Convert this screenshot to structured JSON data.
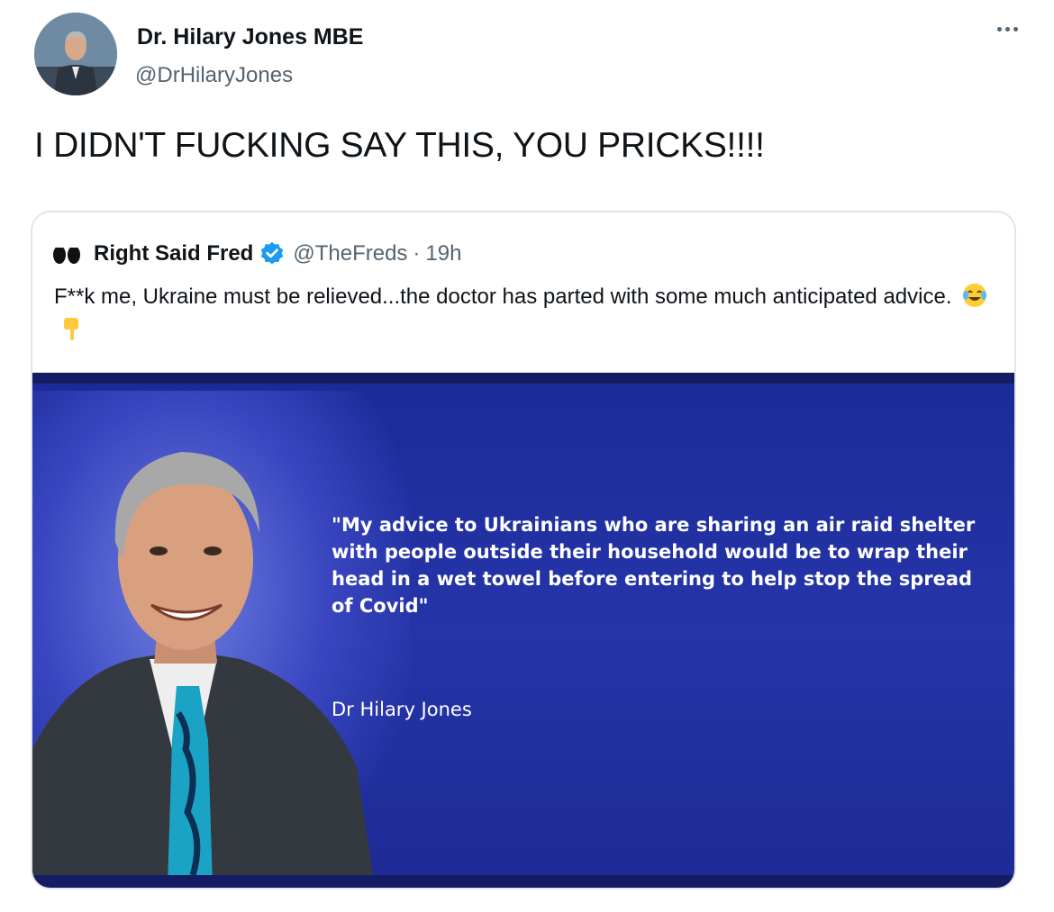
{
  "author": {
    "name": "Dr. Hilary Jones MBE",
    "handle": "@DrHilaryJones"
  },
  "tweet": {
    "text": "I DIDN'T FUCKING SAY THIS, YOU PRICKS!!!!"
  },
  "quoted_tweet": {
    "name": "Right Said Fred",
    "handle": "@TheFreds",
    "separator": "·",
    "time": "19h",
    "text": "F**k me, Ukraine must be relieved...the doctor has parted with some much anticipated advice.",
    "emojis": [
      "face-with-tears-of-joy",
      "backhand-index-pointing-down"
    ],
    "image": {
      "quote": "\"My advice to Ukrainians who are sharing an air raid shelter with people outside their household would be to wrap their head in a wet towel before entering to help stop the spread of Covid\"",
      "attribution": "Dr Hilary Jones",
      "background_color": "#2535a8"
    }
  },
  "icons": {
    "more": "more-horizontal-icon",
    "verified": "verified-badge-icon"
  },
  "colors": {
    "text": "#0f1419",
    "secondary": "#536471",
    "verified": "#1d9bf0"
  }
}
